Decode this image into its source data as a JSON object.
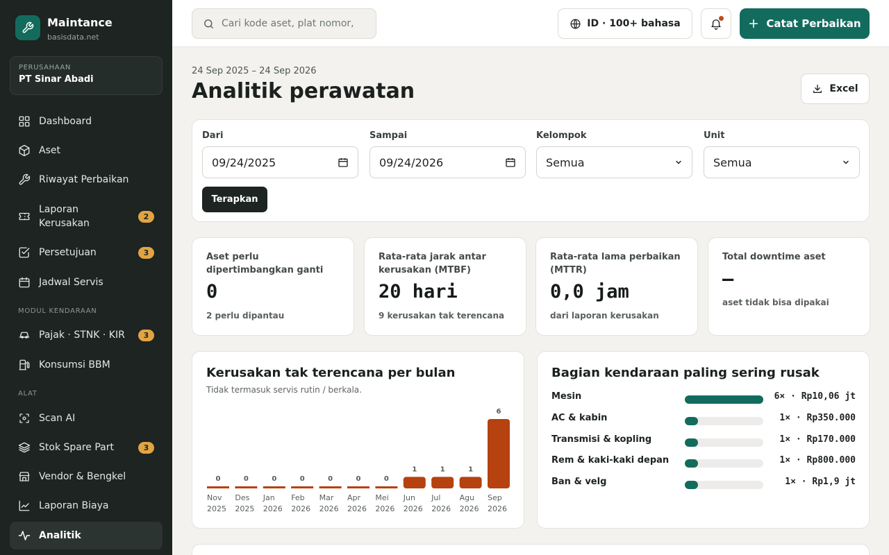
{
  "app": {
    "name": "Maintance",
    "domain": "basisdata.net"
  },
  "company": {
    "label": "PERUSAHAAN",
    "name": "PT Sinar Abadi"
  },
  "sidebar": {
    "items": [
      {
        "label": "Dashboard",
        "icon": "grid-icon"
      },
      {
        "label": "Aset",
        "icon": "cube-icon"
      },
      {
        "label": "Riwayat Perbaikan",
        "icon": "wrench-icon"
      },
      {
        "label": "Laporan Kerusakan",
        "icon": "ticket-icon",
        "badge": "2"
      },
      {
        "label": "Persetujuan",
        "icon": "check-square-icon",
        "badge": "3"
      },
      {
        "label": "Jadwal Servis",
        "icon": "calendar-icon"
      }
    ],
    "section_vehicle": "MODUL KENDARAAN",
    "vehicle_items": [
      {
        "label": "Pajak · STNK · KIR",
        "icon": "car-icon",
        "badge": "3"
      },
      {
        "label": "Konsumsi BBM",
        "icon": "fuel-icon"
      }
    ],
    "section_tools": "ALAT",
    "tool_items": [
      {
        "label": "Scan AI",
        "icon": "scan-icon"
      },
      {
        "label": "Stok Spare Part",
        "icon": "layers-icon",
        "badge": "3"
      },
      {
        "label": "Vendor & Bengkel",
        "icon": "store-icon"
      },
      {
        "label": "Laporan Biaya",
        "icon": "line-chart-icon"
      },
      {
        "label": "Analitik",
        "icon": "activity-icon",
        "active": true
      }
    ]
  },
  "topbar": {
    "search_placeholder": "Cari kode aset, plat nomor,",
    "language": "ID · 100+ bahasa",
    "primary_action": "Catat Perbaikan"
  },
  "header": {
    "date_range": "24 Sep 2025 – 24 Sep 2026",
    "title": "Analitik perawatan",
    "export_label": "Excel"
  },
  "filters": {
    "from": {
      "label": "Dari",
      "value": "09/24/2025"
    },
    "to": {
      "label": "Sampai",
      "value": "09/24/2026"
    },
    "group": {
      "label": "Kelompok",
      "value": "Semua"
    },
    "unit": {
      "label": "Unit",
      "value": "Semua"
    },
    "apply_label": "Terapkan"
  },
  "kpis": [
    {
      "title": "Aset perlu dipertimbangkan ganti",
      "value": "0",
      "sub": "2 perlu dipantau"
    },
    {
      "title": "Rata-rata jarak antar kerusakan (MTBF)",
      "value": "20 hari",
      "sub": "9 kerusakan tak terencana"
    },
    {
      "title": "Rata-rata lama perbaikan (MTTR)",
      "value": "0,0 jam",
      "sub": "dari laporan kerusakan"
    },
    {
      "title": "Total downtime aset",
      "value": "—",
      "sub": "aset tidak bisa dipakai"
    }
  ],
  "monthly_chart": {
    "title": "Kerusakan tak terencana per bulan",
    "subtitle": "Tidak termasuk servis rutin / berkala.",
    "color": "#b5420f"
  },
  "chart_data": {
    "type": "bar",
    "categories": [
      [
        "Nov",
        "2025"
      ],
      [
        "Des",
        "2025"
      ],
      [
        "Jan",
        "2026"
      ],
      [
        "Feb",
        "2026"
      ],
      [
        "Mar",
        "2026"
      ],
      [
        "Apr",
        "2026"
      ],
      [
        "Mei",
        "2026"
      ],
      [
        "Jun",
        "2026"
      ],
      [
        "Jul",
        "2026"
      ],
      [
        "Agu",
        "2026"
      ],
      [
        "Sep",
        "2026"
      ]
    ],
    "values": [
      0,
      0,
      0,
      0,
      0,
      0,
      0,
      1,
      1,
      1,
      6
    ],
    "ylim": [
      0,
      6
    ],
    "grid": false,
    "data_labels": true
  },
  "parts": {
    "title": "Bagian kendaraan paling sering rusak",
    "color": "#136b5e",
    "max_count": 6,
    "items": [
      {
        "name": "Mesin",
        "count": 6,
        "value": "6× · Rp10,06 jt"
      },
      {
        "name": "AC & kabin",
        "count": 1,
        "value": "1× · Rp350.000"
      },
      {
        "name": "Transmisi & kopling",
        "count": 1,
        "value": "1× · Rp170.000"
      },
      {
        "name": "Rem & kaki-kaki depan",
        "count": 1,
        "value": "1× · Rp800.000"
      },
      {
        "name": "Ban & velg",
        "count": 1,
        "value": "1× · Rp1,9 jt"
      }
    ]
  },
  "colors": {
    "sidebar_bg": "#1d2421",
    "accent": "#136b5e",
    "badge": "#e2a443",
    "bar": "#b5420f",
    "notification_dot": "#bf4a1c"
  }
}
